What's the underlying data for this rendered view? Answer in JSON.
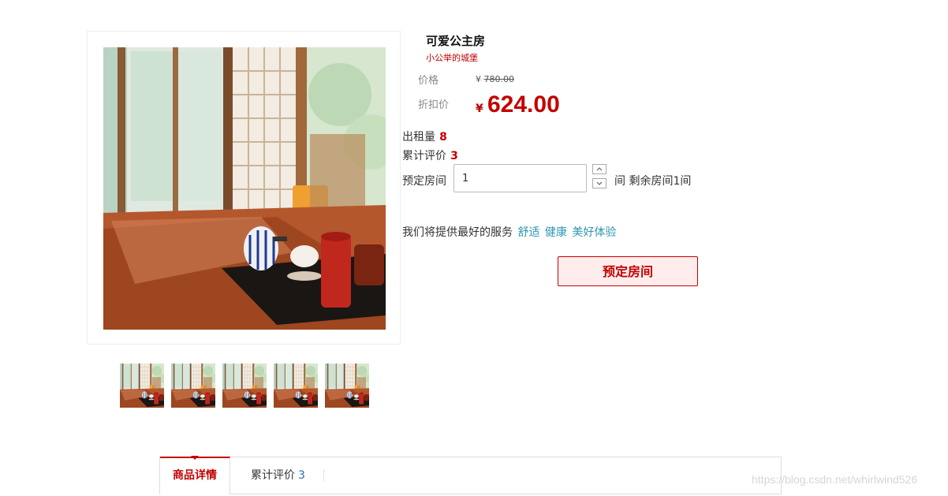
{
  "product": {
    "title": "可爱公主房",
    "subtitle": "小公举的城堡",
    "price_label": "价格",
    "currency": "¥",
    "original_price": "780.00",
    "discount_label": "折扣价",
    "discount_price": "624.00"
  },
  "stats": {
    "rented_label": "出租量",
    "rented_count": "8",
    "reviews_label": "累计评价",
    "reviews_count": "3"
  },
  "booking": {
    "label": "预定房间",
    "quantity": "1",
    "unit": "间",
    "remaining": "剩余房间1间",
    "button_label": "预定房间"
  },
  "service": {
    "text": "我们将提供最好的服务",
    "tags": [
      "舒适",
      "健康",
      "美好体验"
    ]
  },
  "tabs": {
    "details": "商品详情",
    "reviews_label": "累计评价",
    "reviews_count": "3"
  },
  "watermark": "https://blog.csdn.net/whirlwind526",
  "colors": {
    "accent": "#c40000",
    "link": "#2b97b1",
    "button_bg": "#ffeded"
  },
  "images": {
    "main": "room-photo",
    "thumbnails": [
      "room-photo",
      "room-photo",
      "room-photo",
      "room-photo",
      "room-photo"
    ]
  }
}
